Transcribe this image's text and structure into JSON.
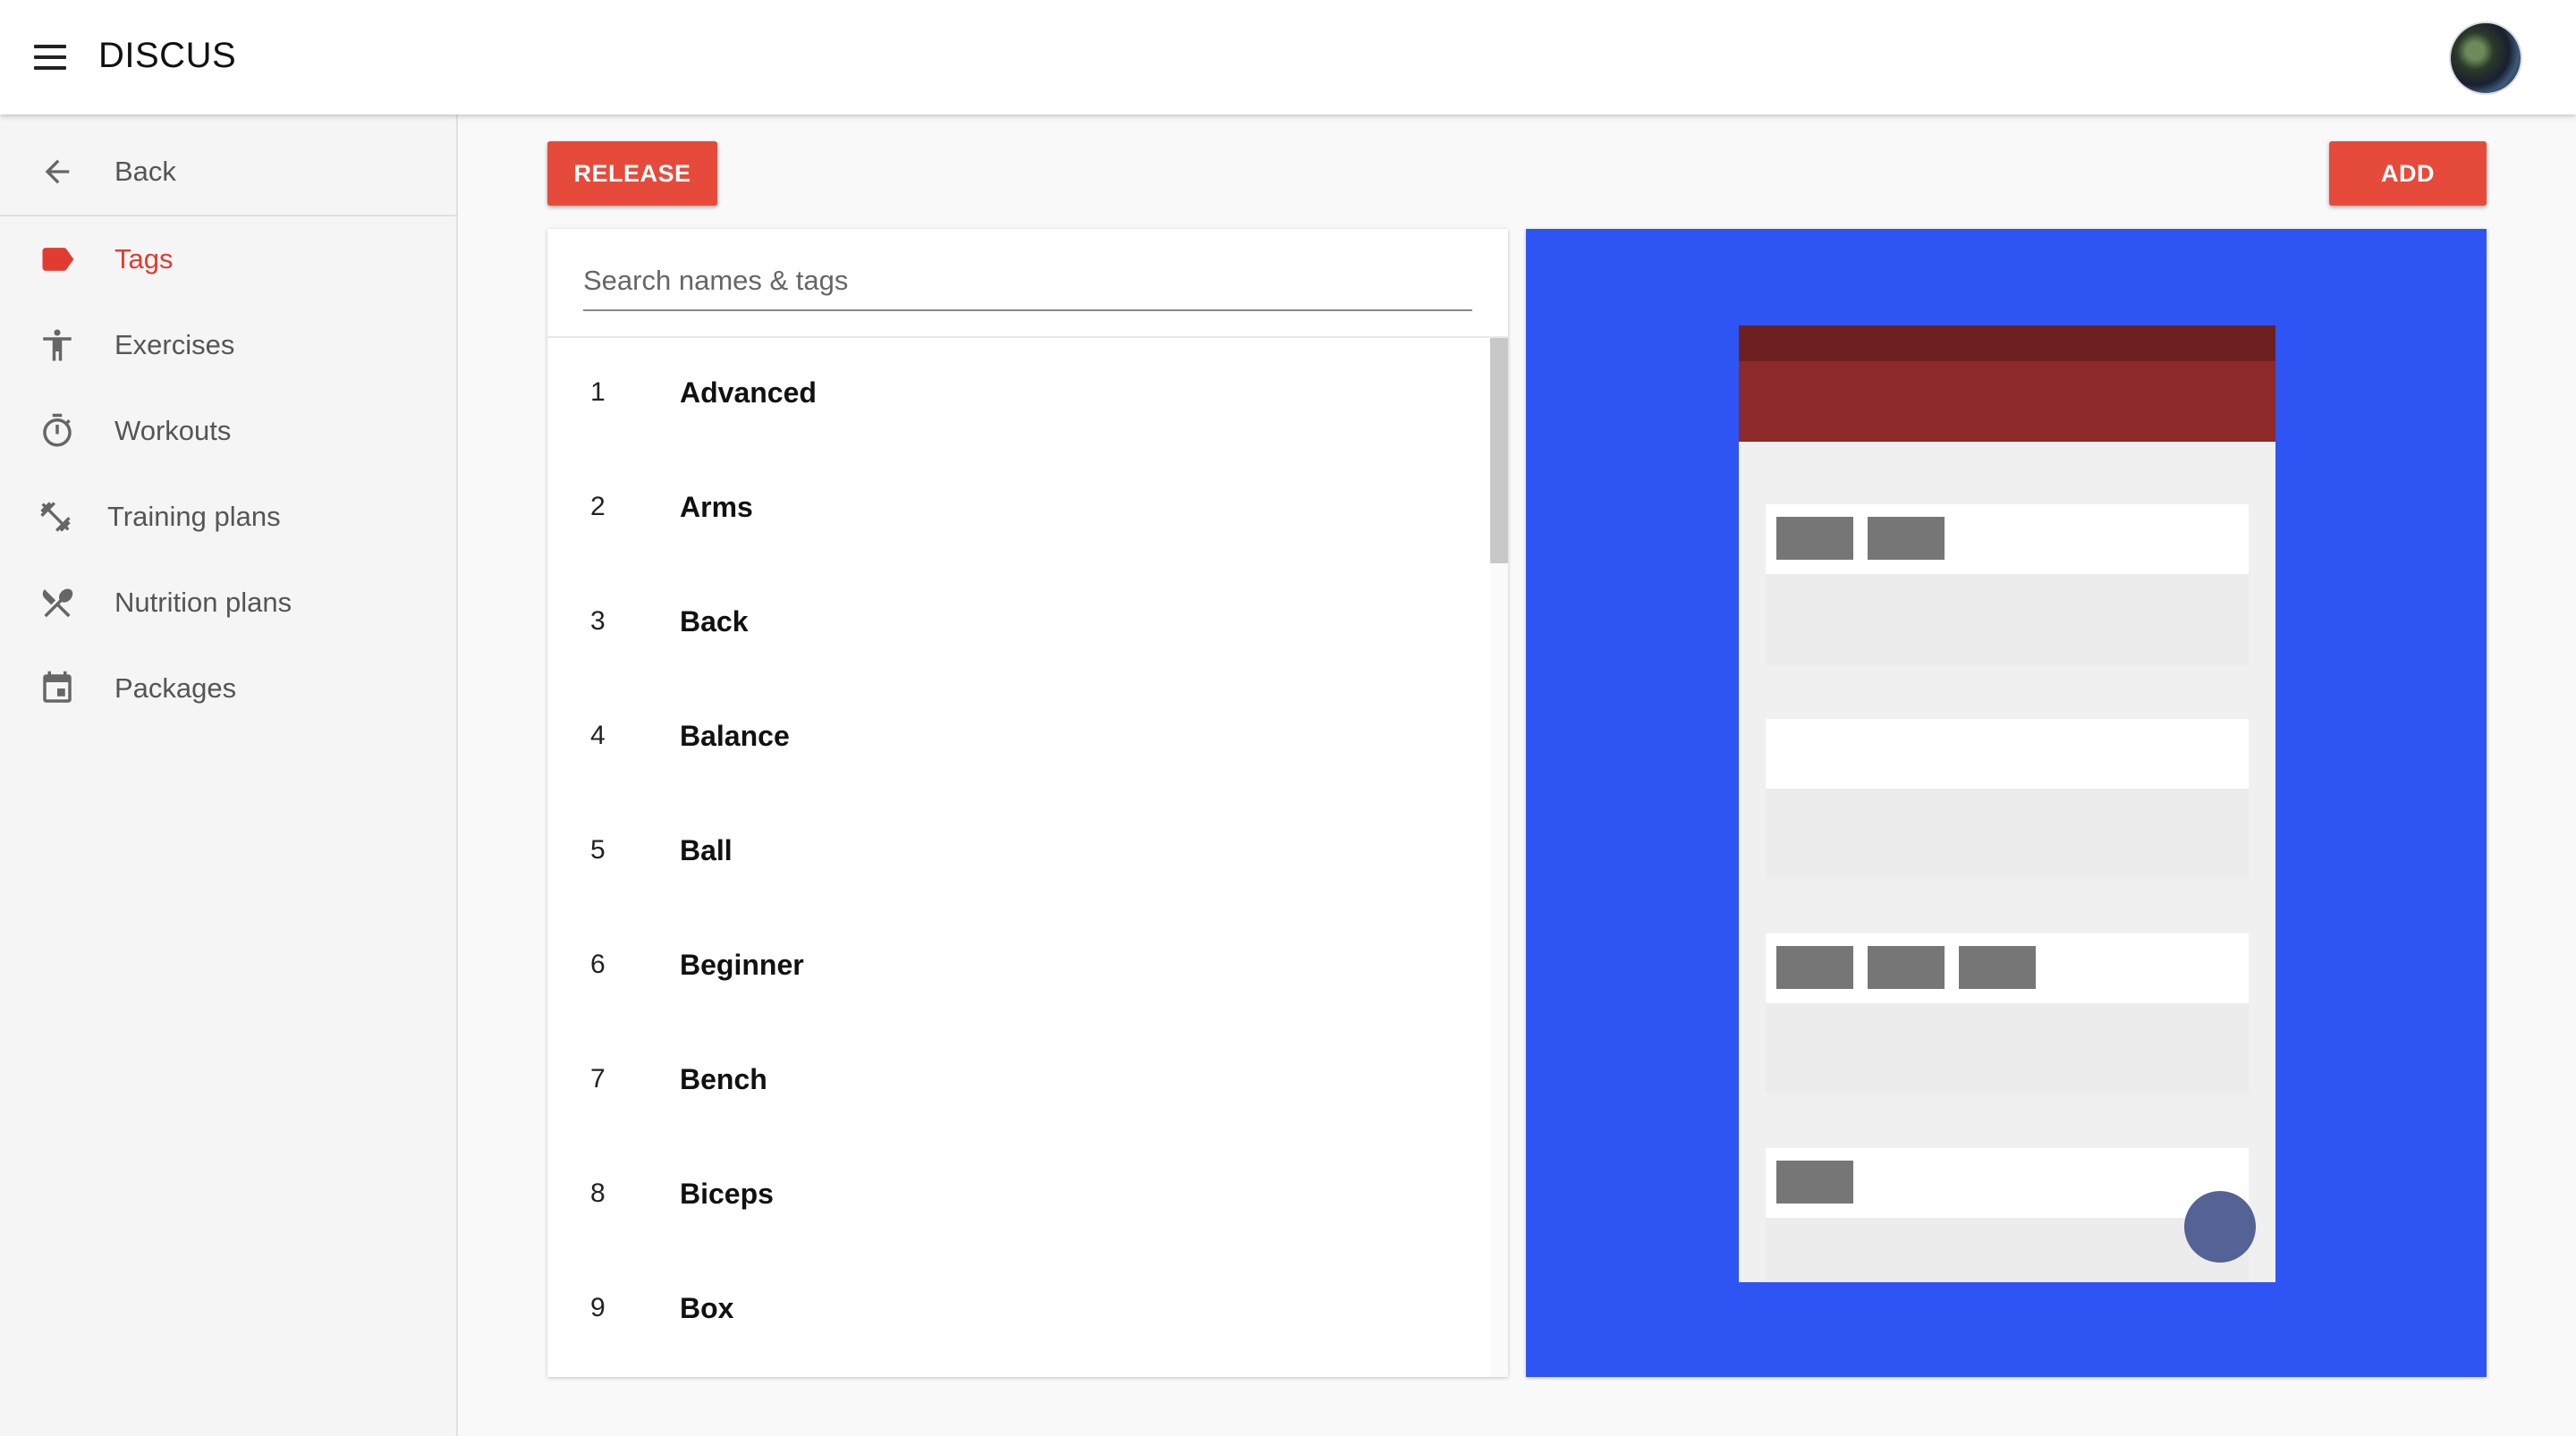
{
  "header": {
    "app_title": "DISCUS"
  },
  "sidebar": {
    "items": [
      {
        "label": "Back",
        "icon": "arrow-back-icon",
        "active": false
      },
      {
        "label": "Tags",
        "icon": "label-icon",
        "active": true
      },
      {
        "label": "Exercises",
        "icon": "accessibility-icon",
        "active": false
      },
      {
        "label": "Workouts",
        "icon": "timer-icon",
        "active": false
      },
      {
        "label": "Training plans",
        "icon": "dumbbell-icon",
        "active": false
      },
      {
        "label": "Nutrition plans",
        "icon": "utensils-icon",
        "active": false
      },
      {
        "label": "Packages",
        "icon": "calendar-icon",
        "active": false
      }
    ]
  },
  "toolbar": {
    "release_label": "RELEASE",
    "add_label": "ADD"
  },
  "search": {
    "placeholder": "Search names & tags",
    "value": ""
  },
  "tags": [
    {
      "num": "1",
      "name": "Advanced"
    },
    {
      "num": "2",
      "name": "Arms"
    },
    {
      "num": "3",
      "name": "Back"
    },
    {
      "num": "4",
      "name": "Balance"
    },
    {
      "num": "5",
      "name": "Ball"
    },
    {
      "num": "6",
      "name": "Beginner"
    },
    {
      "num": "7",
      "name": "Bench"
    },
    {
      "num": "8",
      "name": "Biceps"
    },
    {
      "num": "9",
      "name": "Box"
    }
  ],
  "colors": {
    "accent": "#e64a3b",
    "active_nav": "#e03c31",
    "preview_bg": "#2f54f4",
    "phone_status": "#6e2020",
    "phone_appbar": "#8e2929",
    "phone_fab": "#556296"
  }
}
